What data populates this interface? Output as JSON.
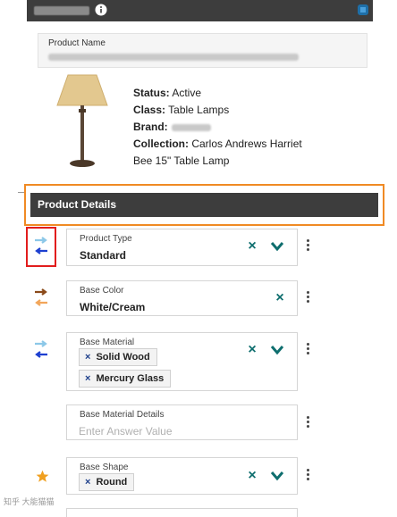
{
  "header": {
    "title_redacted": true,
    "icons": [
      "info-icon",
      "corner-badge-icon"
    ]
  },
  "product_name": {
    "label": "Product Name",
    "value_redacted": true
  },
  "product_info": {
    "status_label": "Status:",
    "status_value": "Active",
    "class_label": "Class:",
    "class_value": "Table Lamps",
    "brand_label": "Brand:",
    "collection_label": "Collection:",
    "collection_value": "Carlos Andrews Harriet",
    "collection_value_line2": "Bee 15\" Table Lamp"
  },
  "section": {
    "title": "Product Details"
  },
  "fields": {
    "product_type": {
      "label": "Product Type",
      "value": "Standard"
    },
    "base_color": {
      "label": "Base Color",
      "value": "White/Cream"
    },
    "base_material": {
      "label": "Base Material",
      "chips": [
        "Solid Wood",
        "Mercury Glass"
      ]
    },
    "base_material_details": {
      "label": "Base Material Details",
      "placeholder": "Enter Answer Value"
    },
    "base_shape": {
      "label": "Base Shape",
      "chips": [
        "Round"
      ]
    }
  },
  "icons": {
    "clear": "×",
    "expand": "chevron-down-icon",
    "more": "kebab-icon",
    "chip_remove": "×"
  },
  "watermark": {
    "text": "知乎 大能猫猫"
  },
  "colors": {
    "accent_teal": "#0e6e6e",
    "highlight_orange": "#f08a24",
    "highlight_red": "#e21d1d",
    "arrow_blue": "#1d3fd0",
    "arrow_light_blue": "#8cc8e8",
    "arrow_brown": "#8b4a1a",
    "arrow_orange": "#f2a65a",
    "star": "#f0a020"
  }
}
